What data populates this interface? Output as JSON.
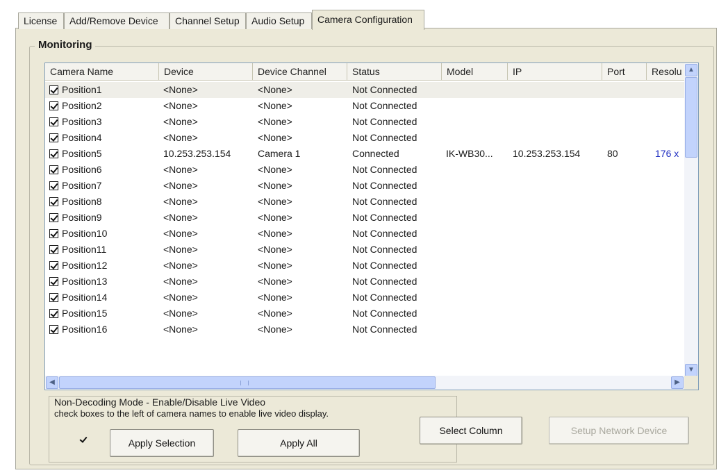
{
  "tabs": [
    "License",
    "Add/Remove Device",
    "Channel Setup",
    "Audio Setup",
    "Camera Configuration"
  ],
  "group_title": "Monitoring",
  "columns": [
    "Camera Name",
    "Device",
    "Device Channel",
    "Status",
    "Model",
    "IP",
    "Port",
    "Resolu"
  ],
  "rows": [
    {
      "name": "Position1",
      "device": "<None>",
      "channel": "<None>",
      "status": "Not Connected",
      "model": "",
      "ip": "",
      "port": "",
      "res": ""
    },
    {
      "name": "Position2",
      "device": "<None>",
      "channel": "<None>",
      "status": "Not Connected",
      "model": "",
      "ip": "",
      "port": "",
      "res": ""
    },
    {
      "name": "Position3",
      "device": "<None>",
      "channel": "<None>",
      "status": "Not Connected",
      "model": "",
      "ip": "",
      "port": "",
      "res": ""
    },
    {
      "name": "Position4",
      "device": "<None>",
      "channel": "<None>",
      "status": "Not Connected",
      "model": "",
      "ip": "",
      "port": "",
      "res": ""
    },
    {
      "name": "Position5",
      "device": "10.253.253.154",
      "channel": "Camera 1",
      "status": "Connected",
      "model": "IK-WB30...",
      "ip": "10.253.253.154",
      "port": "80",
      "res": "176 x"
    },
    {
      "name": "Position6",
      "device": "<None>",
      "channel": "<None>",
      "status": "Not Connected",
      "model": "",
      "ip": "",
      "port": "",
      "res": ""
    },
    {
      "name": "Position7",
      "device": "<None>",
      "channel": "<None>",
      "status": "Not Connected",
      "model": "",
      "ip": "",
      "port": "",
      "res": ""
    },
    {
      "name": "Position8",
      "device": "<None>",
      "channel": "<None>",
      "status": "Not Connected",
      "model": "",
      "ip": "",
      "port": "",
      "res": ""
    },
    {
      "name": "Position9",
      "device": "<None>",
      "channel": "<None>",
      "status": "Not Connected",
      "model": "",
      "ip": "",
      "port": "",
      "res": ""
    },
    {
      "name": "Position10",
      "device": "<None>",
      "channel": "<None>",
      "status": "Not Connected",
      "model": "",
      "ip": "",
      "port": "",
      "res": ""
    },
    {
      "name": "Position11",
      "device": "<None>",
      "channel": "<None>",
      "status": "Not Connected",
      "model": "",
      "ip": "",
      "port": "",
      "res": ""
    },
    {
      "name": "Position12",
      "device": "<None>",
      "channel": "<None>",
      "status": "Not Connected",
      "model": "",
      "ip": "",
      "port": "",
      "res": ""
    },
    {
      "name": "Position13",
      "device": "<None>",
      "channel": "<None>",
      "status": "Not Connected",
      "model": "",
      "ip": "",
      "port": "",
      "res": ""
    },
    {
      "name": "Position14",
      "device": "<None>",
      "channel": "<None>",
      "status": "Not Connected",
      "model": "",
      "ip": "",
      "port": "",
      "res": ""
    },
    {
      "name": "Position15",
      "device": "<None>",
      "channel": "<None>",
      "status": "Not Connected",
      "model": "",
      "ip": "",
      "port": "",
      "res": ""
    },
    {
      "name": "Position16",
      "device": "<None>",
      "channel": "<None>",
      "status": "Not Connected",
      "model": "",
      "ip": "",
      "port": "",
      "res": ""
    }
  ],
  "ndm": {
    "line1": "Non-Decoding Mode - Enable/Disable Live Video",
    "line2": "check boxes to the left of camera names to enable live video display."
  },
  "buttons": {
    "apply_selection": "Apply Selection",
    "apply_all": "Apply All",
    "select_column": "Select Column",
    "setup_network_device": "Setup Network Device"
  },
  "colors": {
    "resolution_text": "#1c2bc0",
    "scroll_accent": "#c2d3fc"
  }
}
